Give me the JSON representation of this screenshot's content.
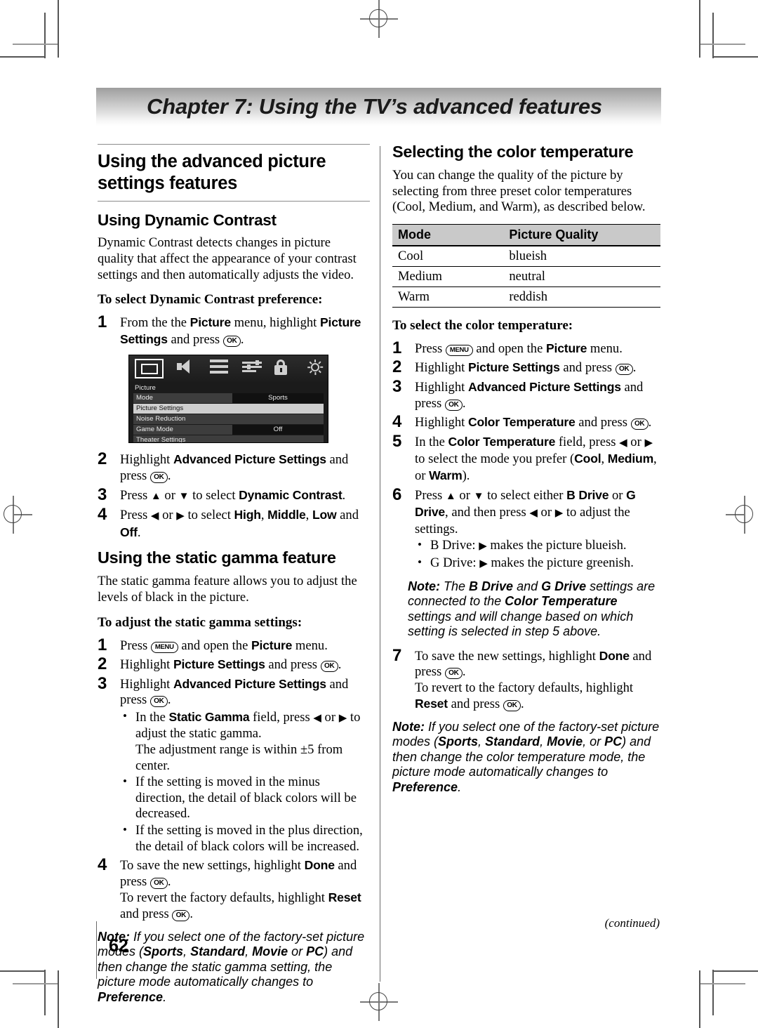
{
  "chapter": {
    "banner_title": "Chapter 7: Using the TV’s advanced features"
  },
  "left_column": {
    "section_title": "Using the advanced picture settings features",
    "dynamic_contrast": {
      "heading": "Using Dynamic Contrast",
      "intro": "Dynamic Contrast detects changes in picture quality that affect the appearance of your contrast settings and then automatically adjusts the video.",
      "lead_in": "To select Dynamic Contrast preference:",
      "step1_a": "From the the ",
      "step1_b": "Picture",
      "step1_c": " menu, highlight ",
      "step1_d": "Picture Settings",
      "step1_e": " and press ",
      "step1_f": ".",
      "step2_a": "Highlight ",
      "step2_b": "Advanced Picture Settings",
      "step2_c": " and press ",
      "step2_d": ".",
      "step3_a": "Press ",
      "step3_arrow_up": "▲",
      "step3_b": " or ",
      "step3_arrow_down": "▼",
      "step3_c": " to select ",
      "step3_d": "Dynamic Contrast",
      "step3_e": ".",
      "step4_a": "Press ",
      "step4_arrow_left": "◀",
      "step4_b": " or ",
      "step4_arrow_right": "▶",
      "step4_c": " to select ",
      "step4_d": "High",
      "step4_e": ", ",
      "step4_f": "Middle",
      "step4_g": ", ",
      "step4_h": "Low",
      "step4_i": " and ",
      "step4_j": "Off",
      "step4_k": "."
    },
    "tv_menu": {
      "icons": [
        "screen-icon",
        "speaker-icon",
        "bars-icon",
        "sliders-icon",
        "lock-icon",
        "sun-icon"
      ],
      "panel_title": "Picture",
      "rows": [
        {
          "name": "Mode",
          "value": "Sports",
          "highlighted": false,
          "has_value": true
        },
        {
          "name": "Picture Settings",
          "value": "",
          "highlighted": true,
          "has_value": false
        },
        {
          "name": "Noise Reduction",
          "value": "",
          "highlighted": false,
          "has_value": false
        },
        {
          "name": "Game Mode",
          "value": "Off",
          "highlighted": false,
          "has_value": true
        },
        {
          "name": "Theater Settings",
          "value": "",
          "highlighted": false,
          "has_value": false
        }
      ]
    },
    "static_gamma": {
      "heading": "Using the static gamma feature",
      "intro": "The static gamma feature allows you to adjust the levels of black in the picture.",
      "lead_in": "To adjust the static gamma settings:",
      "step1_a": "Press ",
      "step1_b": " and open the ",
      "step1_c": "Picture",
      "step1_d": " menu.",
      "step2_a": "Highlight ",
      "step2_b": "Picture Settings",
      "step2_c": " and press ",
      "step2_d": ".",
      "step3_a": "Highlight ",
      "step3_b": "Advanced Picture Settings",
      "step3_c": " and press ",
      "step3_d": ".",
      "bullet1_a": "In the ",
      "bullet1_b": "Static Gamma",
      "bullet1_c": " field, press ",
      "bullet1_left": "◀",
      "bullet1_d": " or ",
      "bullet1_right": "▶",
      "bullet1_e": " to adjust the static gamma.",
      "bullet1_f": "The adjustment range is within ±5 from center.",
      "bullet2": "If the setting is moved in the minus direction, the detail of black colors will be decreased.",
      "bullet3": "If the setting is moved in the plus direction, the detail of black colors will be increased.",
      "step4_a": "To save the new settings, highlight ",
      "step4_b": "Done",
      "step4_c": " and press ",
      "step4_d": ".",
      "step4_e": "To revert the factory defaults, highlight ",
      "step4_f": "Reset",
      "step4_g": " and press ",
      "step4_h": ".",
      "note_label": "Note:",
      "note_a": " If you select one of the factory-set picture modes (",
      "note_b": "Sports",
      "note_c": ", ",
      "note_d": "Standard",
      "note_e": ", ",
      "note_f": "Movie",
      "note_g": " or ",
      "note_h": "PC",
      "note_i": ") and then change the static gamma setting, the picture mode automatically changes to ",
      "note_j": "Preference",
      "note_k": "."
    }
  },
  "right_column": {
    "color_temperature": {
      "heading": "Selecting the color temperature",
      "intro": "You can change the quality of the picture by selecting from three preset color temperatures (Cool, Medium, and Warm), as described below.",
      "table": {
        "headers": [
          "Mode",
          "Picture Quality"
        ],
        "rows": [
          [
            "Cool",
            "blueish"
          ],
          [
            "Medium",
            "neutral"
          ],
          [
            "Warm",
            "reddish"
          ]
        ]
      },
      "lead_in": "To select the color temperature:",
      "step1_a": "Press ",
      "step1_b": " and open the ",
      "step1_c": "Picture",
      "step1_d": " menu.",
      "step2_a": "Highlight ",
      "step2_b": "Picture Settings",
      "step2_c": " and press ",
      "step2_d": ".",
      "step3_a": "Highlight ",
      "step3_b": "Advanced Picture Settings",
      "step3_c": " and press ",
      "step3_d": ".",
      "step4_a": "Highlight ",
      "step4_b": "Color Temperature",
      "step4_c": " and press ",
      "step4_d": ".",
      "step5_a": "In the ",
      "step5_b": "Color Temperature",
      "step5_c": " field, press ",
      "step5_left": "◀",
      "step5_d": " or ",
      "step5_right": "▶",
      "step5_e": " to select the mode you prefer (",
      "step5_f": "Cool",
      "step5_g": ", ",
      "step5_h": "Medium",
      "step5_i": ", or ",
      "step5_j": "Warm",
      "step5_k": ").",
      "step6_a": "Press ",
      "step6_up": "▲",
      "step6_b": " or ",
      "step6_down": "▼",
      "step6_c": " to select either ",
      "step6_d": "B Drive",
      "step6_e": " or ",
      "step6_f": "G Drive",
      "step6_g": ", and then press ",
      "step6_left": "◀",
      "step6_h": " or ",
      "step6_right": "▶",
      "step6_i": " to adjust the settings.",
      "bullet_b_a": "B Drive: ",
      "bullet_b_arrow": "▶",
      "bullet_b_b": " makes the picture blueish.",
      "bullet_g_a": "G Drive: ",
      "bullet_g_arrow": "▶",
      "bullet_g_b": " makes the picture greenish.",
      "note1_label": "Note:",
      "note1_a": " The ",
      "note1_b": "B Drive",
      "note1_c": " and ",
      "note1_d": "G Drive",
      "note1_e": " settings are connected to the ",
      "note1_f": "Color Temperature",
      "note1_g": " settings and will change based on which setting is selected in step 5 above.",
      "step7_a": "To save the new settings, highlight ",
      "step7_b": "Done",
      "step7_c": " and press ",
      "step7_d": ".",
      "step7_e": "To revert to the factory defaults, highlight ",
      "step7_f": "Reset",
      "step7_g": " and press ",
      "step7_h": ".",
      "note2_label": "Note:",
      "note2_a": " If you select one of the factory-set picture modes (",
      "note2_b": "Sports",
      "note2_c": ", ",
      "note2_d": "Standard",
      "note2_e": ", ",
      "note2_f": "Movie",
      "note2_g": ", or ",
      "note2_h": "PC",
      "note2_i": ") and then change the color temperature mode, the picture mode automatically changes to ",
      "note2_j": "Preference",
      "note2_k": "."
    }
  },
  "footer": {
    "continued": "(continued)",
    "page_number": "62"
  },
  "buttons": {
    "ok_label": "OK",
    "menu_label": "MENU"
  },
  "step_numbers": {
    "n1": "1",
    "n2": "2",
    "n3": "3",
    "n4": "4",
    "n5": "5",
    "n6": "6",
    "n7": "7"
  }
}
